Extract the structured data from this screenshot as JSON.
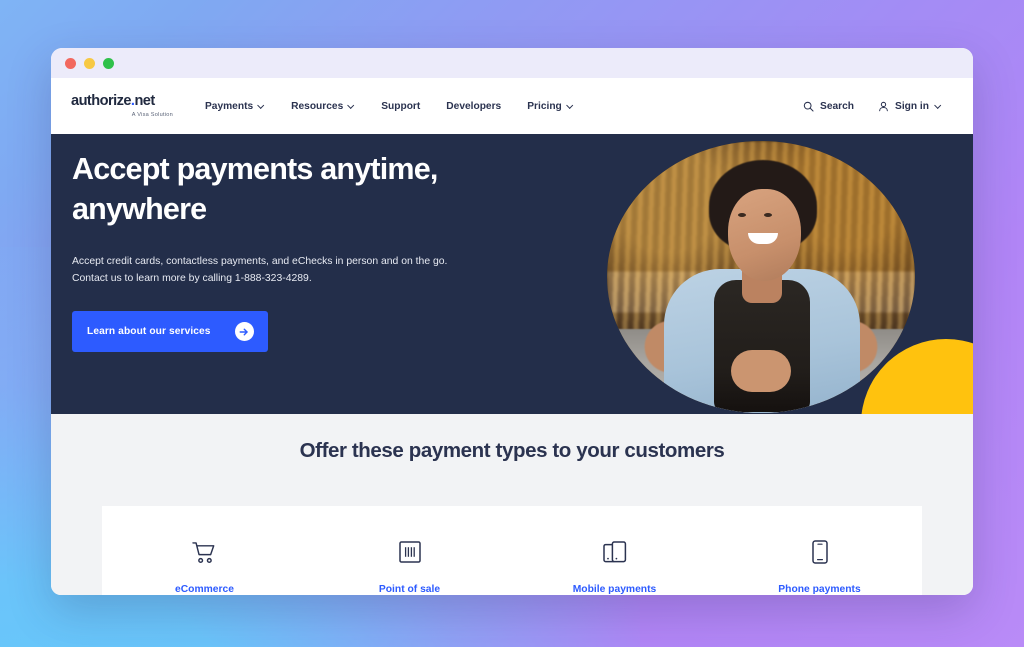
{
  "window": {
    "traffic_lights": [
      "close",
      "minimize",
      "maximize"
    ],
    "colors": {
      "close": "#f2685f",
      "minimize": "#f7c944",
      "maximize": "#2fc14a",
      "titlebar": "#ecebfa"
    }
  },
  "brand": {
    "logo_text_1": "authorize",
    "logo_dot": ".",
    "logo_text_2": "net",
    "tagline": "A Visa Solution"
  },
  "header": {
    "nav": [
      {
        "label": "Payments",
        "has_dropdown": true
      },
      {
        "label": "Resources",
        "has_dropdown": true
      },
      {
        "label": "Support",
        "has_dropdown": false
      },
      {
        "label": "Developers",
        "has_dropdown": false
      },
      {
        "label": "Pricing",
        "has_dropdown": true
      }
    ],
    "search_label": "Search",
    "signin_label": "Sign in"
  },
  "hero": {
    "title": "Accept payments anytime, anywhere",
    "subtitle_line1": "Accept credit cards, contactless payments, and eChecks in person and on the go.",
    "subtitle_line2": "Contact us to learn more by calling 1-888-323-4289.",
    "phone": "1-888-323-4289",
    "cta_label": "Learn about our services",
    "background_color": "#232e4a",
    "cta_color": "#2d5bff",
    "accent_circle_color": "#ffc20e",
    "photo_alt": "Smiling woman in apron leaning on a shop counter"
  },
  "payment_section": {
    "title": "Offer these payment types to your customers",
    "background_color": "#f2f3f5",
    "link_color": "#2d5bff",
    "types": [
      {
        "label": "eCommerce",
        "icon": "shopping-cart-icon"
      },
      {
        "label": "Point of sale",
        "icon": "barcode-terminal-icon"
      },
      {
        "label": "Mobile payments",
        "icon": "mobile-devices-icon"
      },
      {
        "label": "Phone payments",
        "icon": "phone-icon"
      }
    ]
  },
  "page": {
    "gradient_from": "#6fc8f7",
    "gradient_to": "#b98bf7"
  }
}
